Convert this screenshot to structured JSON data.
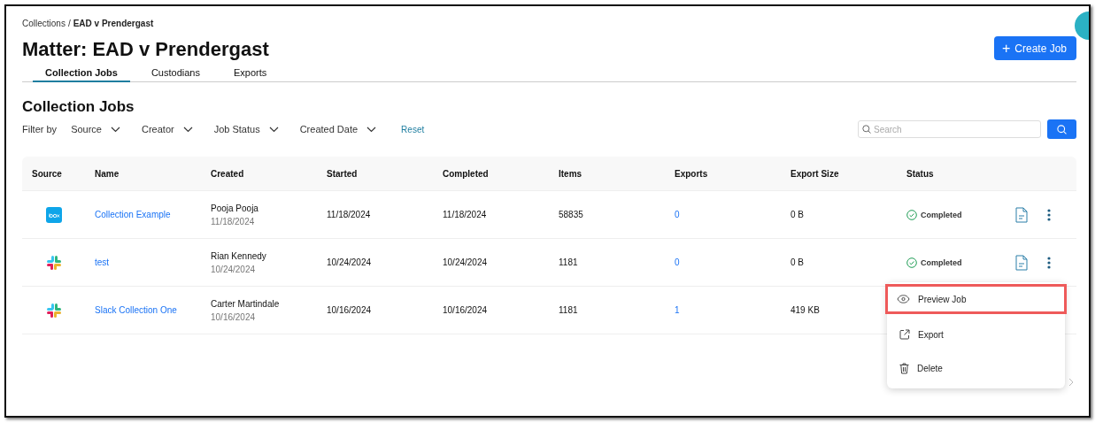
{
  "breadcrumb": {
    "parent": "Collections",
    "separator": "/",
    "current": "EAD v Prendergast"
  },
  "title": "Matter: EAD v Prendergast",
  "create_button": {
    "icon": "+",
    "label": "Create Job"
  },
  "tabs": [
    {
      "label": "Collection Jobs",
      "selected": true
    },
    {
      "label": "Custodians",
      "selected": false
    },
    {
      "label": "Exports",
      "selected": false
    }
  ],
  "section_title": "Collection Jobs",
  "filters": {
    "label": "Filter by",
    "dropdowns": [
      "Source",
      "Creator",
      "Job Status",
      "Created Date"
    ],
    "reset": "Reset"
  },
  "search": {
    "placeholder": "Search"
  },
  "table": {
    "columns": [
      "Source",
      "Name",
      "Created",
      "Started",
      "Completed",
      "Items",
      "Exports",
      "Export Size",
      "Status"
    ],
    "rows": [
      {
        "kind": "box",
        "name": "Collection Example",
        "creator": "Pooja Pooja",
        "created": "11/18/2024",
        "started": "11/18/2024",
        "completed": "11/18/2024",
        "items": "58835",
        "exports": "0",
        "export_size": "0 B",
        "status": "Completed",
        "actions": true
      },
      {
        "kind": "slack",
        "name": "test",
        "creator": "Rian Kennedy",
        "created": "10/24/2024",
        "started": "10/24/2024",
        "completed": "10/24/2024",
        "items": "1181",
        "exports": "0",
        "export_size": "0 B",
        "status": "Completed",
        "actions": true
      },
      {
        "kind": "slack",
        "name": "Slack Collection One",
        "creator": "Carter Martindale",
        "created": "10/16/2024",
        "started": "10/16/2024",
        "completed": "10/16/2024",
        "items": "1181",
        "exports": "1",
        "export_size": "419 KB"
      }
    ]
  },
  "menu": [
    {
      "kind": "preview",
      "label": "Preview Job",
      "highlighted": true
    },
    {
      "kind": "export",
      "label": "Export",
      "highlighted": false
    },
    {
      "kind": "delete",
      "label": "Delete",
      "highlighted": false
    }
  ]
}
